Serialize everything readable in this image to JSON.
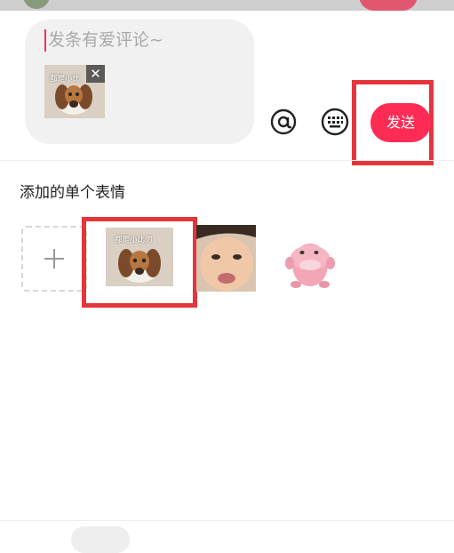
{
  "comment": {
    "placeholder": "发条有爱评论~",
    "attached_caption": "都是小比",
    "remove_glyph": "✕",
    "send_label": "发送"
  },
  "toolbar": {
    "at_icon": "at-icon",
    "keyboard_icon": "keyboard-icon"
  },
  "stickers": {
    "section_title": "添加的单个表情",
    "add_glyph": "+",
    "items": [
      {
        "name": "beagle-puppy",
        "caption": "都是小比的"
      },
      {
        "name": "crying-boy",
        "caption": ""
      },
      {
        "name": "pink-pokemon",
        "caption": ""
      }
    ]
  },
  "colors": {
    "accent": "#fe2c55",
    "highlight": "#e5353c"
  }
}
